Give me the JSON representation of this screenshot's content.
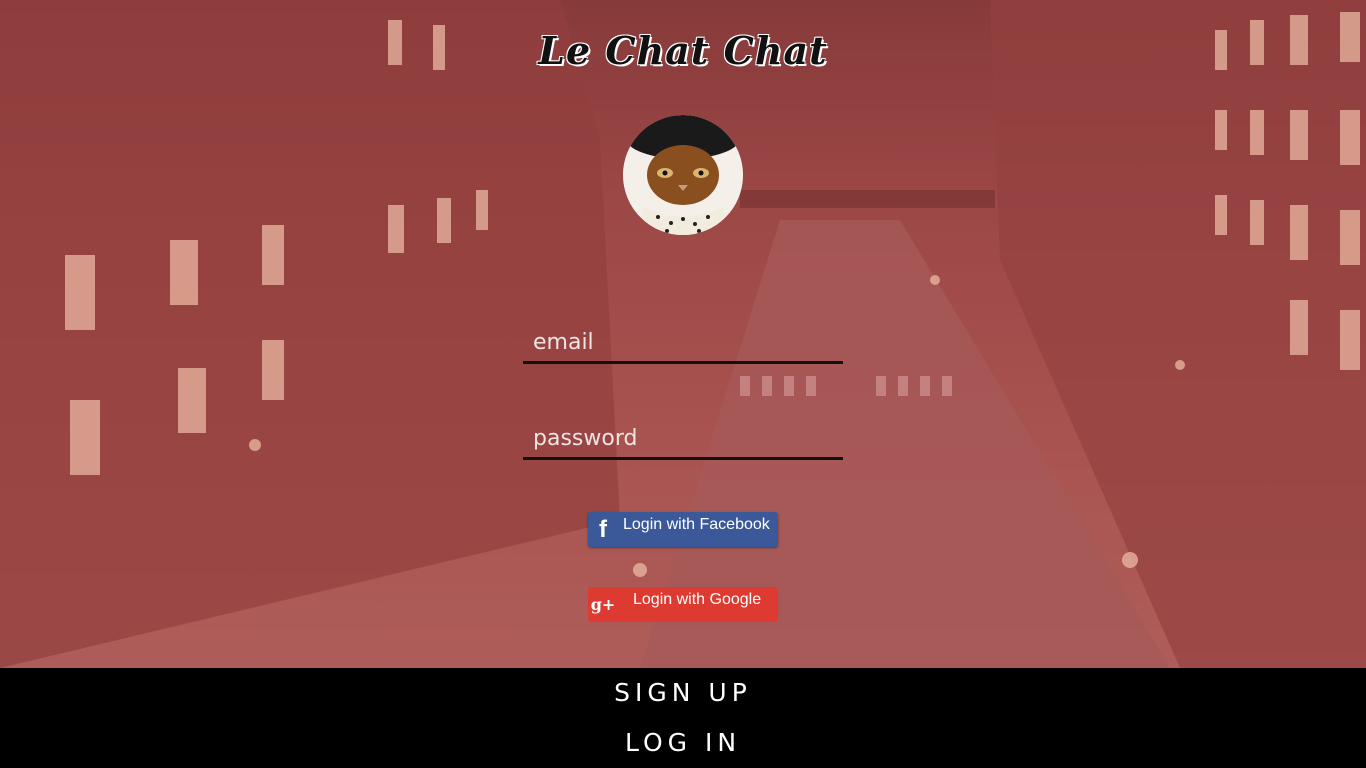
{
  "app": {
    "title": "Le Chat Chat"
  },
  "login_form": {
    "email_placeholder": "email",
    "password_placeholder": "password",
    "facebook_label": "Login with Facebook",
    "google_label": "Login with Google"
  },
  "icons": {
    "facebook": "facebook-f-icon",
    "google": "google-plus-icon",
    "avatar": "cat-avatar"
  },
  "footer": {
    "signup_label": "SIGN UP",
    "login_label": "LOG IN"
  },
  "colors": {
    "facebook": "#3b5998",
    "google": "#dd3b32",
    "footer": "#000000"
  }
}
